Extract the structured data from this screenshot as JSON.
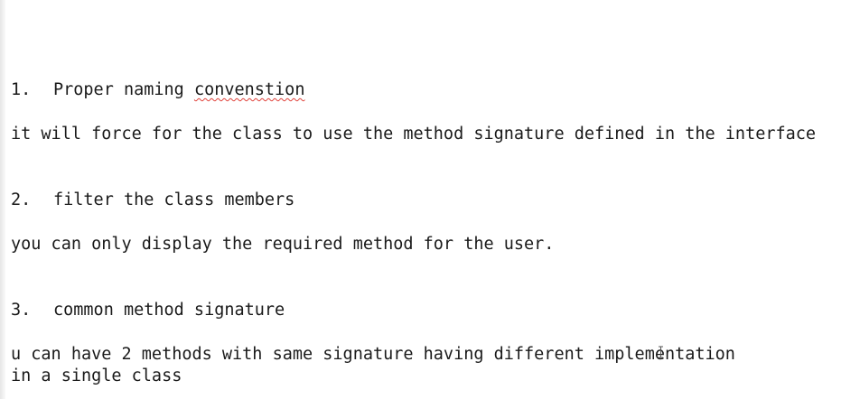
{
  "items": [
    {
      "number": "1.",
      "heading_prefix": "Proper naming ",
      "heading_misspelled": "convenstion",
      "body_1": "it will force for the class to use the method signature defined in the interface",
      "body_2": ""
    },
    {
      "number": "2.",
      "heading_prefix": "filter the class members",
      "heading_misspelled": "",
      "body_1": "you can only display the required method for the user.",
      "body_2": ""
    },
    {
      "number": "3.",
      "heading_prefix": "common method signature",
      "heading_misspelled": "",
      "body_1": "u can have 2 methods with same signature having different implementation",
      "body_2": "in a single class"
    }
  ],
  "icons": {
    "cursor": "text-cursor-icon"
  }
}
